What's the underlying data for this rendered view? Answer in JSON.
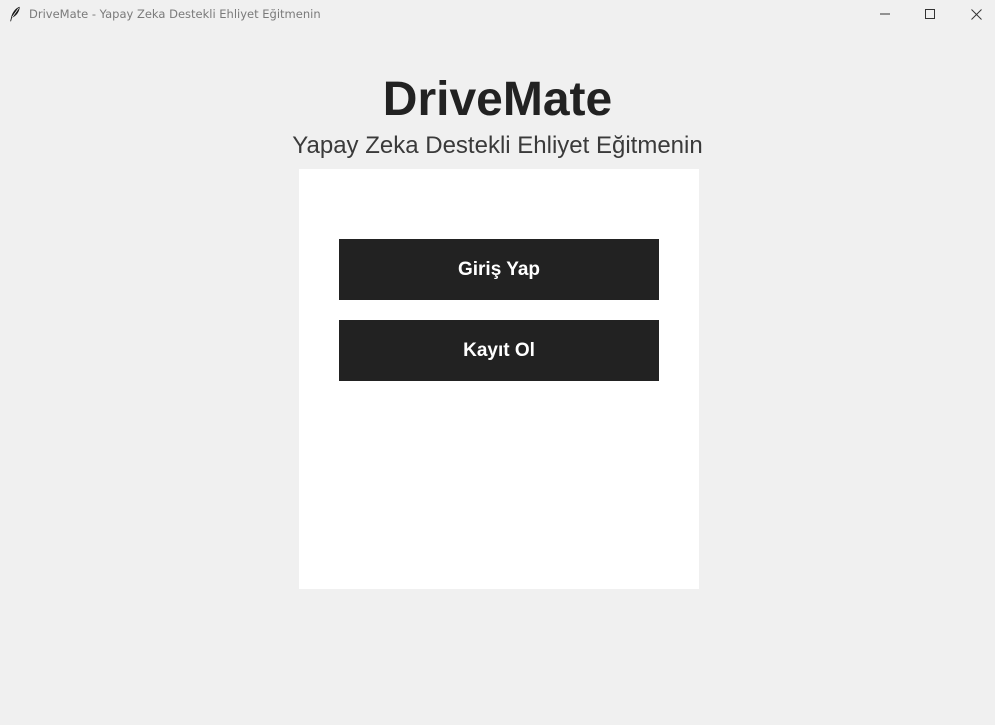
{
  "window": {
    "title": "DriveMate - Yapay Zeka Destekli Ehliyet Eğitmenin",
    "icon": "feather-icon",
    "controls": [
      "minimize-icon",
      "maximize-icon",
      "close-icon"
    ]
  },
  "header": {
    "title": "DriveMate",
    "subtitle": "Yapay Zeka Destekli Ehliyet Eğitmenin"
  },
  "panel": {
    "login_label": "Giriş Yap",
    "register_label": "Kayıt Ol"
  },
  "colors": {
    "background": "#f0f0f0",
    "panel": "#ffffff",
    "button": "#222222",
    "button_text": "#ffffff",
    "title": "#222222"
  }
}
